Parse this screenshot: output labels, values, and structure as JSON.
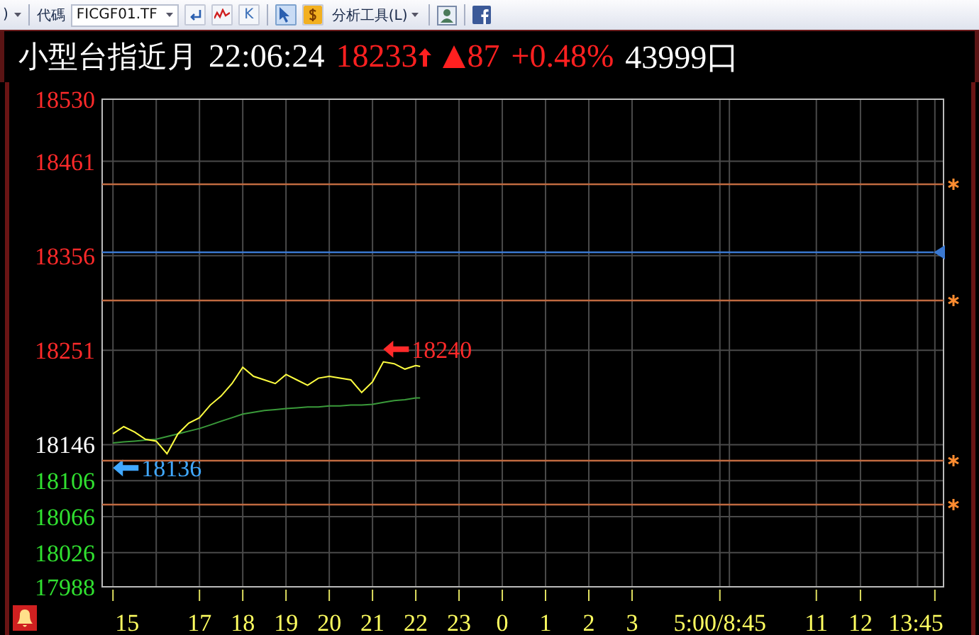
{
  "toolbar": {
    "leading_text": ")",
    "code_label": "代碼",
    "code_field": {
      "value": "FICGF01.TF"
    },
    "tools": [
      {
        "kind": "enter",
        "selected": false
      },
      {
        "kind": "chart",
        "selected": false
      },
      {
        "kind": "k",
        "label": "K",
        "selected": false
      },
      {
        "kind": "pointer",
        "selected": true
      },
      {
        "kind": "dollar",
        "selected": false
      }
    ],
    "analysis_menu": "分析工具(L)"
  },
  "header": {
    "name": "小型台指近月",
    "time": "22:06:24",
    "price": "18233",
    "rising": true,
    "change": "87",
    "percent": "+0.48%",
    "volume": "43999口"
  },
  "chart": {
    "chart_data": {
      "type": "line",
      "x": [
        15,
        15.25,
        15.5,
        15.75,
        16,
        16.25,
        16.5,
        16.75,
        17,
        17.25,
        17.5,
        17.75,
        18,
        18.25,
        18.5,
        18.75,
        19,
        19.25,
        19.5,
        19.75,
        20,
        20.25,
        20.5,
        20.75,
        21,
        21.25,
        21.5,
        21.75,
        22,
        22.1
      ],
      "series": [
        {
          "color": "#ffff40",
          "values": [
            18158,
            18166,
            18160,
            18152,
            18150,
            18136,
            18158,
            18170,
            18176,
            18190,
            18200,
            18214,
            18232,
            18222,
            18218,
            18214,
            18224,
            18218,
            18212,
            18220,
            18222,
            18220,
            18218,
            18204,
            18216,
            18238,
            18236,
            18230,
            18234,
            18233
          ]
        },
        {
          "color": "#3a9a3a",
          "values": [
            18148,
            18149,
            18150,
            18151,
            18152,
            18155,
            18158,
            18161,
            18164,
            18168,
            18172,
            18176,
            18180,
            18182,
            18184,
            18185,
            18186,
            18187,
            18188,
            18188,
            18189,
            18189,
            18190,
            18190,
            18191,
            18193,
            18195,
            18196,
            18198,
            18198
          ]
        }
      ],
      "xlim": [
        14.75,
        34.2
      ],
      "ylim": [
        17988,
        18530
      ],
      "yticks": [
        18530,
        18461,
        18356,
        18251,
        18146,
        18106,
        18066,
        18026,
        17988
      ],
      "xticks": [
        15,
        17,
        18,
        19,
        20,
        21,
        22,
        23
      ],
      "grid": true,
      "annotations": [
        "18240",
        "18136"
      ]
    },
    "x_labels_after": [
      "0",
      "1",
      "2",
      "3",
      "5:00/8:45",
      "11",
      "12",
      "13:45"
    ]
  }
}
